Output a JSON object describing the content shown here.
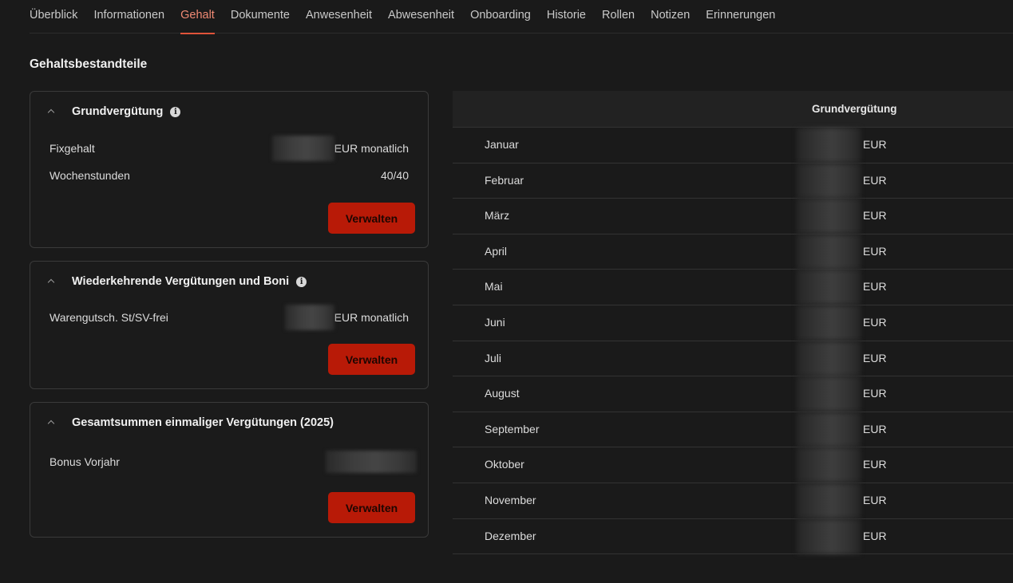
{
  "tabs": [
    {
      "label": "Überblick",
      "active": false
    },
    {
      "label": "Informationen",
      "active": false
    },
    {
      "label": "Gehalt",
      "active": true
    },
    {
      "label": "Dokumente",
      "active": false
    },
    {
      "label": "Anwesenheit",
      "active": false
    },
    {
      "label": "Abwesenheit",
      "active": false
    },
    {
      "label": "Onboarding",
      "active": false
    },
    {
      "label": "Historie",
      "active": false
    },
    {
      "label": "Rollen",
      "active": false
    },
    {
      "label": "Notizen",
      "active": false
    },
    {
      "label": "Erinnerungen",
      "active": false
    }
  ],
  "section_title": "Gehaltsbestandteile",
  "cards": {
    "base": {
      "title": "Grundvergütung",
      "rows": [
        {
          "label": "Fixgehalt",
          "value": "EUR monatlich"
        },
        {
          "label": "Wochenstunden",
          "value": "40/40"
        }
      ],
      "button": "Verwalten"
    },
    "recurring": {
      "title": "Wiederkehrende Vergütungen und Boni",
      "rows": [
        {
          "label": "Warengutsch. St/SV-frei",
          "value": "EUR monatlich"
        }
      ],
      "button": "Verwalten"
    },
    "onetime": {
      "title": "Gesamtsummen einmaliger Vergütungen (2025)",
      "rows": [
        {
          "label": "Bonus Vorjahr",
          "value": ""
        }
      ],
      "button": "Verwalten"
    }
  },
  "table": {
    "header": "Grundvergütung",
    "currency": "EUR",
    "months": [
      "Januar",
      "Februar",
      "März",
      "April",
      "Mai",
      "Juni",
      "Juli",
      "August",
      "September",
      "Oktober",
      "November",
      "Dezember"
    ]
  },
  "colors": {
    "background": "#1a1a1a",
    "accent": "#e0533a",
    "button": "#b81a07"
  }
}
